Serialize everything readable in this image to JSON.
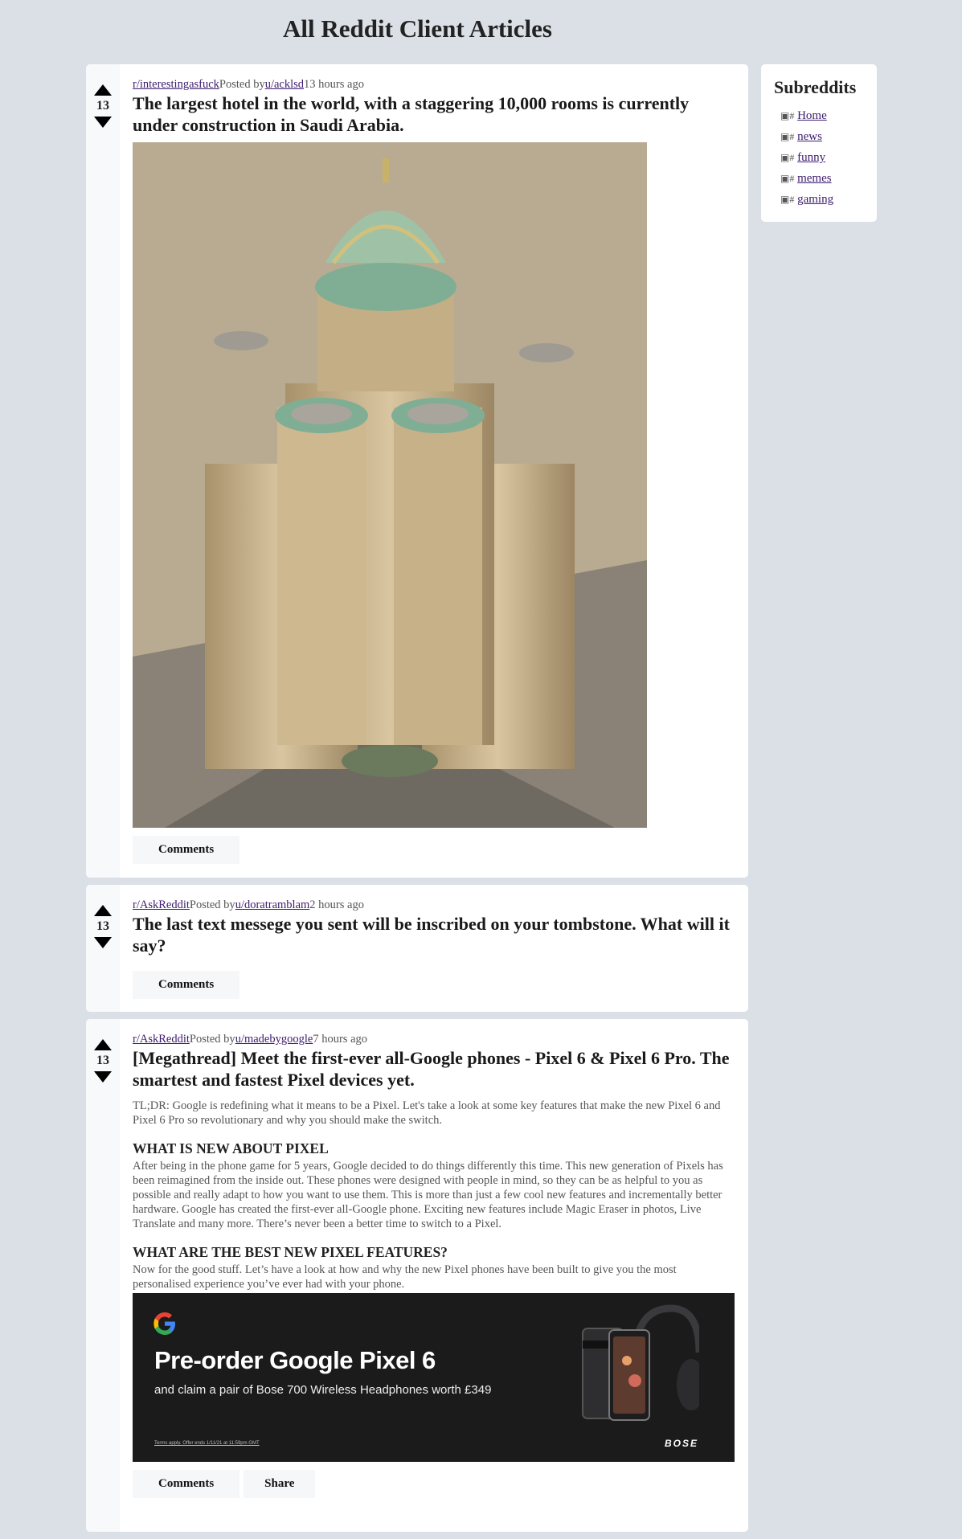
{
  "page": {
    "title": "All Reddit Client Articles"
  },
  "sidebar": {
    "title": "Subreddits",
    "items": [
      {
        "label": "Home",
        "icon_alt": "#"
      },
      {
        "label": "news",
        "icon_alt": "#"
      },
      {
        "label": "funny",
        "icon_alt": "#"
      },
      {
        "label": "memes",
        "icon_alt": "#"
      },
      {
        "label": "gaming",
        "icon_alt": "#"
      }
    ]
  },
  "posts": [
    {
      "subreddit": "r/interestingasfuck",
      "posted_by": "Posted by",
      "author": "u/acklsd",
      "time": "13 hours ago",
      "score": "13",
      "title": "The largest hotel in the world, with a staggering 10,000 rooms is currently under construction in Saudi Arabia.",
      "comments_label": "Comments"
    },
    {
      "subreddit": "r/AskReddit",
      "posted_by": "Posted by",
      "author": "u/doratramblam",
      "time": "2 hours ago",
      "score": "13",
      "title": "The last text messege you sent will be inscribed on your tombstone. What will it say?",
      "comments_label": "Comments"
    },
    {
      "subreddit": "r/AskReddit",
      "posted_by": "Posted by",
      "author": "u/madebygoogle",
      "time": "7 hours ago",
      "score": "13",
      "title": "[Megathread] Meet the first-ever all-Google phones - Pixel 6 & Pixel 6 Pro. The smartest and fastest Pixel devices yet.",
      "tldr": "TL;DR: Google is redefining what it means to be a Pixel. Let's take a look at some key features that make the new Pixel 6 and Pixel 6 Pro so revolutionary and why you should make the switch.",
      "h1": "WHAT IS NEW ABOUT PIXEL",
      "p1": "After being in the phone game for 5 years, Google decided to do things differently this time. This new generation of Pixels has been reimagined from the inside out. These phones were designed with people in mind, so they can be as helpful to you as possible and really adapt to how you want to use them. This is more than just a few cool new features and incrementally better hardware. Google has created the first-ever all-Google phone. Exciting new features include Magic Eraser in photos, Live Translate and many more. There’s never been a better time to switch to a Pixel.",
      "h2": "WHAT ARE THE BEST NEW PIXEL FEATURES?",
      "p2": "Now for the good stuff. Let’s have a look at how and why the new Pixel phones have been built to give you the most personalised experience you’ve ever had with your phone.",
      "ad": {
        "headline": "Pre-order Google Pixel 6",
        "sub": "and claim a pair of Bose 700 Wireless Headphones worth £349",
        "terms": "Terms apply. Offer ends 1/11/21 at 11:59pm GMT",
        "brand": "BOSE"
      },
      "comments_label": "Comments",
      "share_label": "Share"
    }
  ]
}
